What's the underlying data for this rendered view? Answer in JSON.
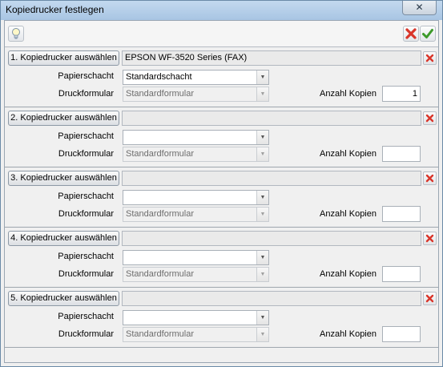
{
  "window": {
    "title": "Kopiedrucker festlegen",
    "close_glyph": "✕"
  },
  "toolbar": {
    "hint_icon": "lightbulb-icon",
    "cancel_icon": "red-x-icon",
    "ok_icon": "green-check-icon"
  },
  "labels": {
    "papierschacht": "Papierschacht",
    "druckformular": "Druckformular",
    "anzahl_kopien": "Anzahl Kopien",
    "combo_arrow": "▼"
  },
  "sections": [
    {
      "button_label": "1. Kopiedrucker auswählen",
      "printer": "EPSON WF-3520 Series (FAX)",
      "papierschacht": "Standardschacht",
      "druckformular": "Standardformular",
      "anzahl_kopien": "1"
    },
    {
      "button_label": "2. Kopiedrucker auswählen",
      "printer": "",
      "papierschacht": "",
      "druckformular": "Standardformular",
      "anzahl_kopien": ""
    },
    {
      "button_label": "3. Kopiedrucker auswählen",
      "printer": "",
      "papierschacht": "",
      "druckformular": "Standardformular",
      "anzahl_kopien": ""
    },
    {
      "button_label": "4. Kopiedrucker auswählen",
      "printer": "",
      "papierschacht": "",
      "druckformular": "Standardformular",
      "anzahl_kopien": ""
    },
    {
      "button_label": "5. Kopiedrucker auswählen",
      "printer": "",
      "papierschacht": "",
      "druckformular": "Standardformular",
      "anzahl_kopien": ""
    }
  ],
  "colors": {
    "delete_red": "#d9352a",
    "ok_green": "#3c9a2a",
    "titlebar": "#b7cfe9"
  }
}
